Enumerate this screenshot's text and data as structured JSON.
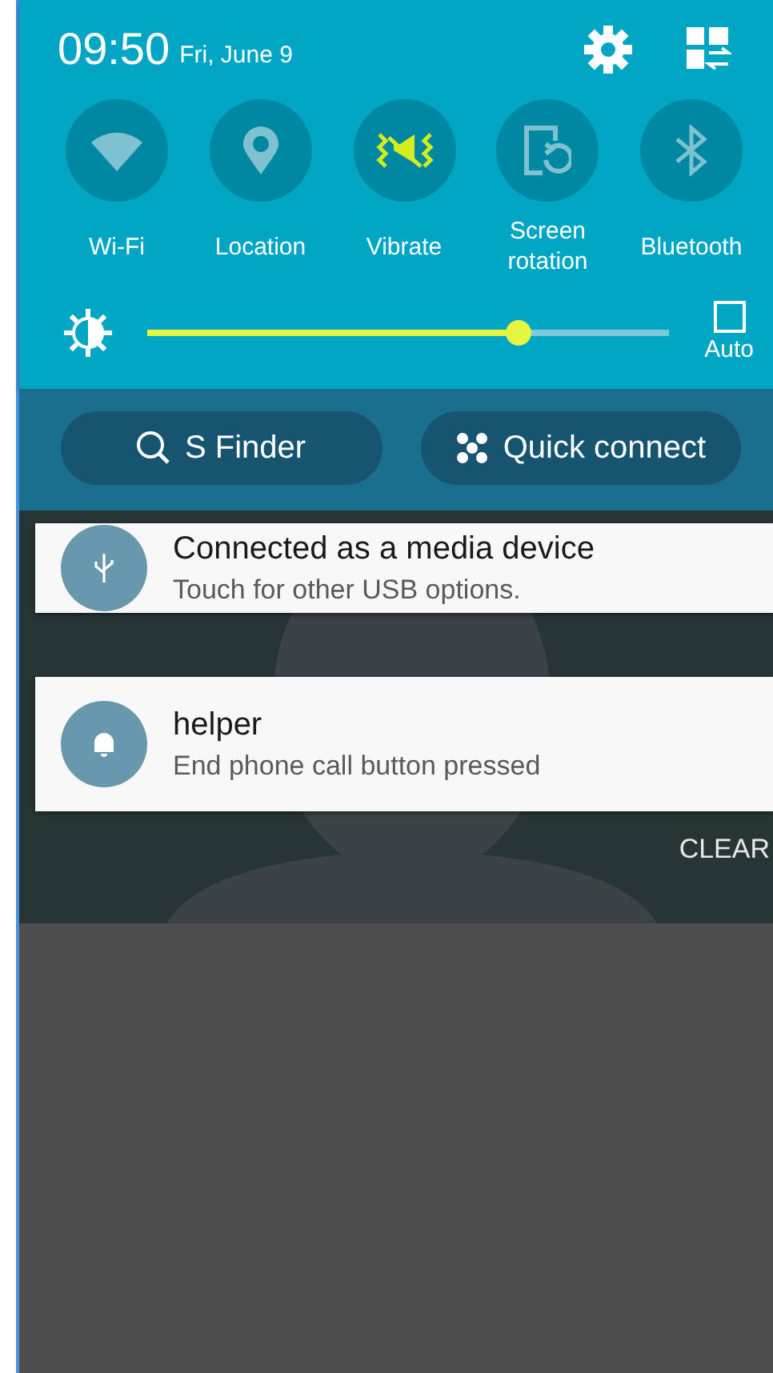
{
  "status": {
    "time": "09:50",
    "date": "Fri, June 9"
  },
  "toggles": [
    {
      "kind": "wifi",
      "label": "Wi-Fi",
      "on": false
    },
    {
      "kind": "location",
      "label": "Location",
      "on": false
    },
    {
      "kind": "vibrate",
      "label": "Vibrate",
      "on": true
    },
    {
      "kind": "rotation",
      "label": "Screen rotation",
      "on": false
    },
    {
      "kind": "bluetooth",
      "label": "Bluetooth",
      "on": false
    }
  ],
  "brightness": {
    "level": 0.71,
    "auto_label": "Auto",
    "auto_checked": false
  },
  "buttons": [
    {
      "kind": "finder",
      "label": "S Finder"
    },
    {
      "kind": "connect",
      "label": "Quick connect"
    }
  ],
  "notifications": [
    {
      "kind": "usb",
      "title": "Connected as a media device",
      "text": "Touch for other USB options."
    },
    {
      "kind": "bell",
      "title": "helper",
      "text": "End phone call button pressed"
    }
  ],
  "clear_label": "CLEAR"
}
